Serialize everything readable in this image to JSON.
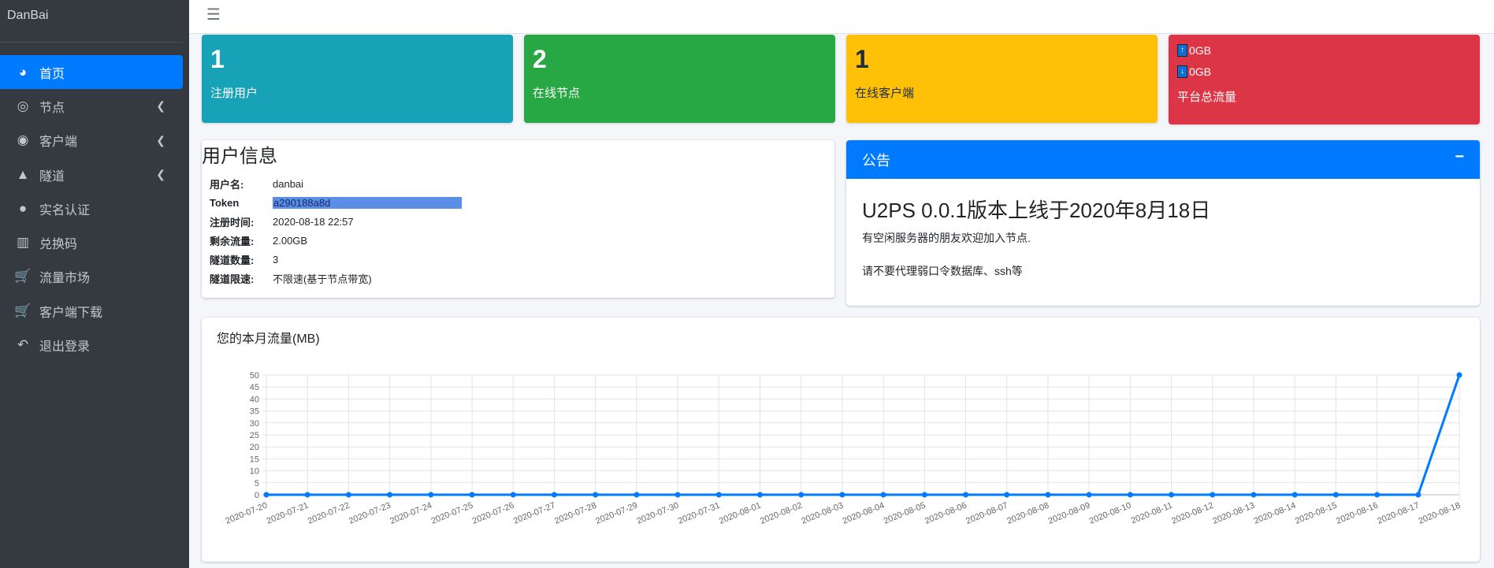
{
  "brand": "DanBai",
  "sidebar": {
    "items": [
      {
        "label": "首页",
        "icon": "tachometer-icon",
        "glyph": "◕",
        "active": true,
        "chevron": false
      },
      {
        "label": "节点",
        "icon": "bullseye-icon",
        "glyph": "◎",
        "chevron": true
      },
      {
        "label": "客户端",
        "icon": "podcast-icon",
        "glyph": "◉",
        "chevron": true
      },
      {
        "label": "隧道",
        "icon": "road-icon",
        "glyph": "▲",
        "chevron": true
      },
      {
        "label": "实名认证",
        "icon": "user-circle-icon",
        "glyph": "●",
        "chevron": false
      },
      {
        "label": "兑换码",
        "icon": "barcode-icon",
        "glyph": "▥",
        "chevron": false
      },
      {
        "label": "流量市场",
        "icon": "cart-icon",
        "glyph": "🛒",
        "chevron": false
      },
      {
        "label": "客户端下载",
        "icon": "cart-icon",
        "glyph": "🛒",
        "chevron": false
      },
      {
        "label": "退出登录",
        "icon": "reply-all-icon",
        "glyph": "↶",
        "chevron": false
      }
    ]
  },
  "stats": [
    {
      "value": "1",
      "label": "注册用户",
      "color": "#17a2b8"
    },
    {
      "value": "2",
      "label": "在线节点",
      "color": "#28a745"
    },
    {
      "value": "1",
      "label": "在线客户端",
      "color": "#ffc107"
    }
  ],
  "traffic": {
    "up": "0GB",
    "down": "0GB",
    "label": "平台总流量",
    "color": "#dc3545"
  },
  "user_info": {
    "title": "用户信息",
    "rows": [
      {
        "k": "用户名:",
        "v": "danbai"
      },
      {
        "k": "Token",
        "v": "a290188a8d"
      },
      {
        "k": "注册时间:",
        "v": "2020-08-18 22:57"
      },
      {
        "k": "剩余流量:",
        "v": "2.00GB"
      },
      {
        "k": "隧道数量:",
        "v": "3"
      },
      {
        "k": "隧道限速:",
        "v": "不限速(基于节点带宽)"
      }
    ]
  },
  "announcement": {
    "title": "公告",
    "collapse": "−",
    "heading": "U2PS 0.0.1版本上线于2020年8月18日",
    "lines": [
      "有空闲服务器的朋友欢迎加入节点.",
      "请不要代理弱口令数据库、ssh等"
    ]
  },
  "chart_data": {
    "type": "line",
    "title": "您的本月流量(MB)",
    "xlabel": "",
    "ylabel": "",
    "ylim": [
      0,
      50
    ],
    "yticks": [
      0,
      5,
      10,
      15,
      20,
      25,
      30,
      35,
      40,
      45,
      50
    ],
    "grid": true,
    "color": "#007bff",
    "x": [
      "2020-07-20",
      "2020-07-21",
      "2020-07-22",
      "2020-07-23",
      "2020-07-24",
      "2020-07-25",
      "2020-07-26",
      "2020-07-27",
      "2020-07-28",
      "2020-07-29",
      "2020-07-30",
      "2020-07-31",
      "2020-08-01",
      "2020-08-02",
      "2020-08-03",
      "2020-08-04",
      "2020-08-05",
      "2020-08-06",
      "2020-08-07",
      "2020-08-08",
      "2020-08-09",
      "2020-08-10",
      "2020-08-11",
      "2020-08-12",
      "2020-08-13",
      "2020-08-14",
      "2020-08-15",
      "2020-08-16",
      "2020-08-17",
      "2020-08-18"
    ],
    "values": [
      0,
      0,
      0,
      0,
      0,
      0,
      0,
      0,
      0,
      0,
      0,
      0,
      0,
      0,
      0,
      0,
      0,
      0,
      0,
      0,
      0,
      0,
      0,
      0,
      0,
      0,
      0,
      0,
      0,
      50
    ]
  }
}
